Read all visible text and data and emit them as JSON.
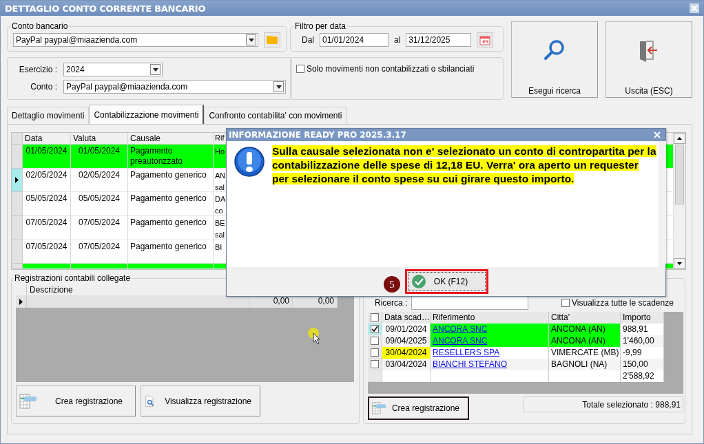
{
  "window": {
    "title": "DETTAGLIO CONTO CORRENTE BANCARIO"
  },
  "conto_bancario": {
    "label": "Conto bancario",
    "value": "PayPal paypal@miaazienda.com"
  },
  "filtro_data": {
    "label": "Filtro per data",
    "from_label": "Dal",
    "from": "01/01/2024",
    "to_label": "al",
    "to": "31/12/2025"
  },
  "esercizio": {
    "label": "Esercizio :",
    "value": "2024"
  },
  "conto": {
    "label": "Conto :",
    "value": "PayPal paypal@miaazienda.com"
  },
  "filter_checkbox": {
    "label": "Solo movimenti non contabilizzati o sbilanciati",
    "checked": false
  },
  "actions": [
    {
      "kind": "search",
      "label": "Esegui ricerca"
    },
    {
      "kind": "exit",
      "label": "Uscita (ESC)"
    }
  ],
  "tabs": [
    {
      "label": "Dettaglio movimenti",
      "selected": false
    },
    {
      "label": "Contabilizzazione movimenti",
      "selected": true
    },
    {
      "label": "Confronto contabilita' con movimenti",
      "selected": false
    }
  ],
  "movements": {
    "columns": [
      "Data",
      "Valuta",
      "Causale",
      "Rif"
    ],
    "rows": [
      {
        "data": "01/05/2024",
        "valuta": "01/05/2024",
        "causale": "Pagamento preautorizzato",
        "riferimento": "Ho",
        "highlighted": true,
        "current": false
      },
      {
        "data": "02/05/2024",
        "valuta": "02/05/2024",
        "causale": "Pagamento generico",
        "riferimento": "AN sal",
        "highlighted": false,
        "current": true
      },
      {
        "data": "05/05/2024",
        "valuta": "05/05/2024",
        "causale": "Pagamento generico",
        "riferimento": "DA co",
        "highlighted": false,
        "current": false
      },
      {
        "data": "07/05/2024",
        "valuta": "07/05/2024",
        "causale": "Pagamento generico",
        "riferimento": "BE sal",
        "highlighted": false,
        "current": false
      },
      {
        "data": "07/05/2024",
        "valuta": "07/05/2024",
        "causale": "Pagamento generico",
        "riferimento": "BI",
        "highlighted": false,
        "current": false
      },
      {
        "highlighted": true,
        "current": false
      }
    ]
  },
  "registrazioni": {
    "title": "Registrazioni contabili collegate",
    "columns": [
      "Descrizione"
    ],
    "rows": [
      {
        "dare": "0,00",
        "avere": "0,00",
        "current": true
      }
    ],
    "buttons": [
      {
        "kind": "create",
        "label": "Crea registrazione"
      },
      {
        "kind": "view",
        "label": "Visualizza registrazione"
      }
    ]
  },
  "scadenze": {
    "search_label": "Ricerca :",
    "show_all": {
      "label": "Visualizza tutte le scadenze",
      "checked": false
    },
    "header_checked": false,
    "columns": [
      "Data scad…",
      "Riferimento",
      "Citta'",
      "Importo"
    ],
    "rows": [
      {
        "checked": true,
        "current": true,
        "data": "09/01/2024",
        "riferimento": "ANCORA SNC",
        "citta": "ANCONA (AN)",
        "importo": "988,91",
        "color": "#00ff00",
        "kind": "reference"
      },
      {
        "checked": false,
        "current": false,
        "data": "09/04/2025",
        "riferimento": "ANCORA SNC",
        "citta": "ANCONA (AN)",
        "importo": "1'460,00",
        "color": "#00ff00",
        "kind": "reference"
      },
      {
        "checked": false,
        "current": false,
        "data": "30/04/2024",
        "riferimento": "RESELLERS SPA",
        "citta": "VIMERCATE (MB)",
        "importo": "-9,99",
        "color": "#ffff00",
        "kind": "date"
      },
      {
        "checked": false,
        "current": false,
        "data": "03/04/2024",
        "riferimento": "BIANCHI STEFANO",
        "citta": "BAGNOLI (NA)",
        "importo": "150,00"
      }
    ],
    "total": "2'588,92",
    "button": "Crea registrazione",
    "selected_total": "Totale selezionato : 988,91"
  },
  "dialog": {
    "title": "INFORMAZIONE READY PRO 2025.3.17",
    "message": "Sulla causale selezionata non e' selezionato un conto di contropartita per la contabilizzazione delle spese di 12,18 EU. Verra' ora aperto un requester per selezionare il conto spese su cui girare questo importo.",
    "button": "OK (F12)",
    "step": "5"
  }
}
